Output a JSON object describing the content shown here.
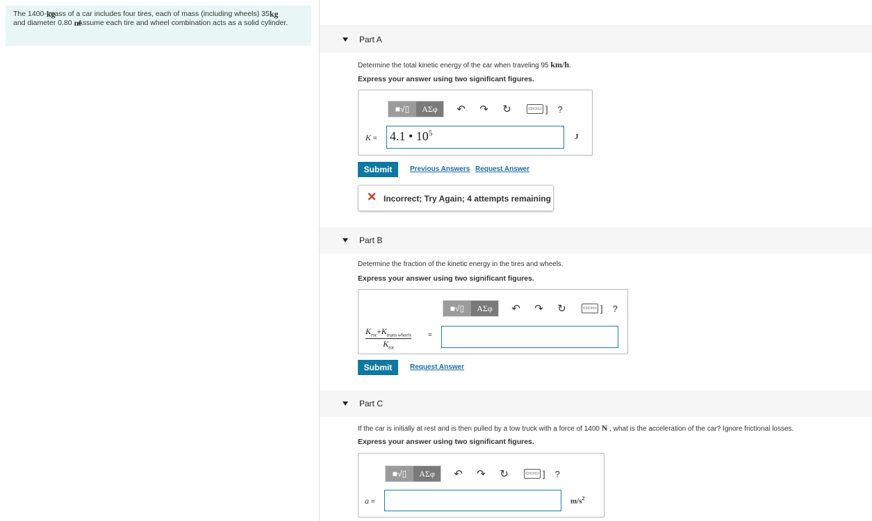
{
  "problem": {
    "t1": "The 1400-",
    "u1": "kg",
    "t2": " mass of a car includes four tires, each of mass (including wheels) 35 ",
    "u2": "kg",
    "t3": "and diameter 0.80 ",
    "u3": "m",
    "t4": ". Assume each tire and wheel combination acts as a solid cylinder."
  },
  "toolbar": {
    "template_label": "■√▯",
    "greek_label": "ΑΣφ",
    "undo": "↶",
    "redo": "↷",
    "reset": "↻",
    "keyboard": "▭▭▭",
    "bracket": "]",
    "help": "?"
  },
  "partA": {
    "title": "Part A",
    "question": "Determine the total kinetic energy of the car when traveling 95 ",
    "unit": "km/h",
    "question_end": ".",
    "instruction": "Express your answer using two significant figures.",
    "label": "K",
    "eq": " =",
    "answer_base": "4.1 • 10",
    "answer_exp": "5",
    "answer_unit": "J",
    "submit": "Submit",
    "prev_answers": "Previous Answers",
    "request_answer": "Request Answer",
    "feedback": "Incorrect; Try Again; 4 attempts remaining"
  },
  "partB": {
    "title": "Part B",
    "question": "Determine the fraction of the kinetic energy in the tires and wheels.",
    "instruction": "Express your answer using two significant figures.",
    "num_a": "K",
    "num_a_sub": "rot",
    "num_plus": "+",
    "num_b": "K",
    "num_b_sub": "trans wheels",
    "den": "K",
    "den_sub": "tot",
    "eq": "=",
    "submit": "Submit",
    "request_answer": "Request Answer"
  },
  "partC": {
    "title": "Part C",
    "question": "If the car is initially at rest and is then pulled by a tow truck with a force of 1400 ",
    "force_unit": "N",
    "question_end": " , what is the acceleration of the car? Ignore frictional losses.",
    "instruction": "Express your answer using two significant figures.",
    "label": "a",
    "eq": " =",
    "answer_unit_base": "m/s",
    "answer_unit_exp": "2"
  }
}
